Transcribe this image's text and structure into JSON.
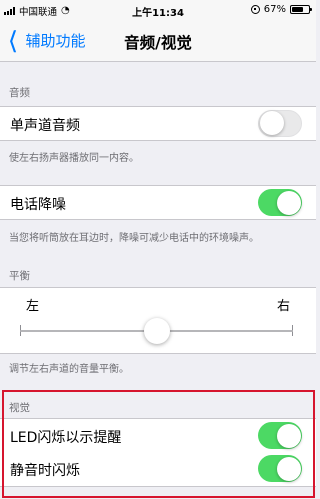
{
  "status_bar": {
    "carrier": "中国联通",
    "wifi_icon": "wifi-icon",
    "time": "上午11:34",
    "battery_percent": "67%",
    "battery_level": 0.67
  },
  "nav": {
    "back_label": "辅助功能",
    "title": "音频/视觉"
  },
  "sections": {
    "audio_header": "音频",
    "mono_audio_label": "单声道音频",
    "mono_audio_on": false,
    "mono_audio_footer": "使左右扬声器播放同一内容。",
    "noise_cancel_label": "电话降噪",
    "noise_cancel_on": true,
    "noise_cancel_footer": "当您将听筒放在耳边时，降噪可减少电话中的环境噪声。",
    "balance_header": "平衡",
    "balance_left": "左",
    "balance_right": "右",
    "balance_value": 0.5,
    "balance_footer": "调节左右声道的音量平衡。",
    "visual_header": "视觉",
    "led_flash_label": "LED闪烁以示提醒",
    "led_flash_on": true,
    "silent_flash_label": "静音时闪烁",
    "silent_flash_on": true
  },
  "colors": {
    "accent": "#007aff",
    "toggle_on": "#4cd964",
    "highlight": "#d6152e"
  }
}
